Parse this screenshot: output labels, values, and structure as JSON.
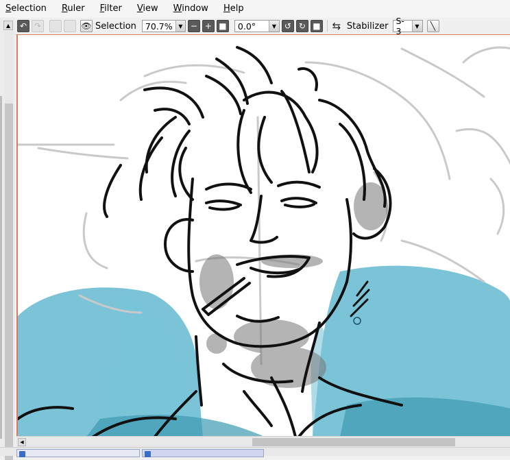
{
  "menubar": {
    "items": [
      {
        "label": "Selection",
        "underline": "S",
        "rest": "election"
      },
      {
        "label": "Ruler",
        "underline": "R",
        "rest": "uler"
      },
      {
        "label": "Filter",
        "underline": "F",
        "rest": "ilter"
      },
      {
        "label": "View",
        "underline": "V",
        "rest": "iew"
      },
      {
        "label": "Window",
        "underline": "W",
        "rest": "indow"
      },
      {
        "label": "Help",
        "underline": "H",
        "rest": "elp"
      }
    ]
  },
  "toolbar": {
    "selection_label": "Selection",
    "zoom_value": "70.7%",
    "rotation_value": "0.0°",
    "stabilizer_label": "Stabilizer",
    "stabilizer_value": "S-3"
  },
  "icons": {
    "undo": "undo-icon",
    "redo": "redo-icon",
    "eye": "eye-icon",
    "zoom_out": "minus-icon",
    "zoom_in": "plus-icon",
    "zoom_reset": "square-icon",
    "rotate_ccw": "rotate-left-icon",
    "rotate_cw": "rotate-right-icon",
    "rotate_reset": "square-icon",
    "flip": "flip-arrows-icon",
    "line_tool": "diagonal-line-icon"
  },
  "colors": {
    "accent_canvas_border": "#e07a5f",
    "paint_blue": "#74c1d6"
  }
}
